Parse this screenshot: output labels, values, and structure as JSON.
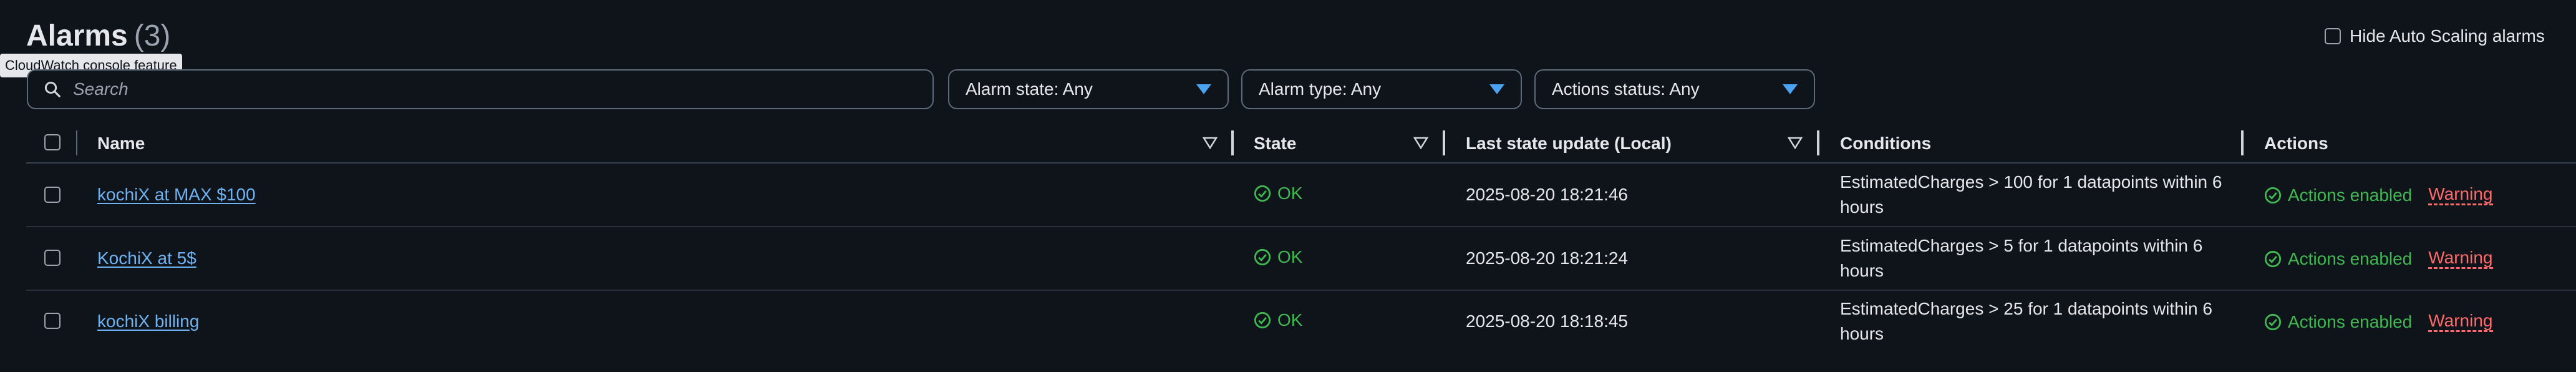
{
  "header": {
    "title": "Alarms",
    "count": "(3)",
    "tooltip": "CloudWatch console feature",
    "hide_auto_scaling_label": "Hide Auto Scaling alarms"
  },
  "filters": {
    "search_placeholder": "Search",
    "alarm_state": "Alarm state: Any",
    "alarm_type": "Alarm type: Any",
    "actions_status": "Actions status: Any"
  },
  "table": {
    "columns": {
      "name": "Name",
      "state": "State",
      "last_update": "Last state update (Local)",
      "conditions": "Conditions",
      "actions": "Actions"
    },
    "rows": [
      {
        "name": "kochiX at MAX $100",
        "state": "OK",
        "last_update": "2025-08-20 18:21:46",
        "conditions": "EstimatedCharges > 100 for 1 datapoints within 6 hours",
        "actions_enabled": "Actions enabled",
        "warning": "Warning"
      },
      {
        "name": "KochiX at 5$",
        "state": "OK",
        "last_update": "2025-08-20 18:21:24",
        "conditions": "EstimatedCharges > 5 for 1 datapoints within 6 hours",
        "actions_enabled": "Actions enabled",
        "warning": "Warning"
      },
      {
        "name": "kochiX billing",
        "state": "OK",
        "last_update": "2025-08-20 18:18:45",
        "conditions": "EstimatedCharges > 25 for 1 datapoints within 6 hours",
        "actions_enabled": "Actions enabled",
        "warning": "Warning"
      }
    ]
  },
  "colors": {
    "background": "#0f141b",
    "ok_green": "#3fb950",
    "link_blue": "#6fb3f3",
    "warning_red": "#ff6b6b",
    "dropdown_arrow": "#4aa3f0"
  }
}
